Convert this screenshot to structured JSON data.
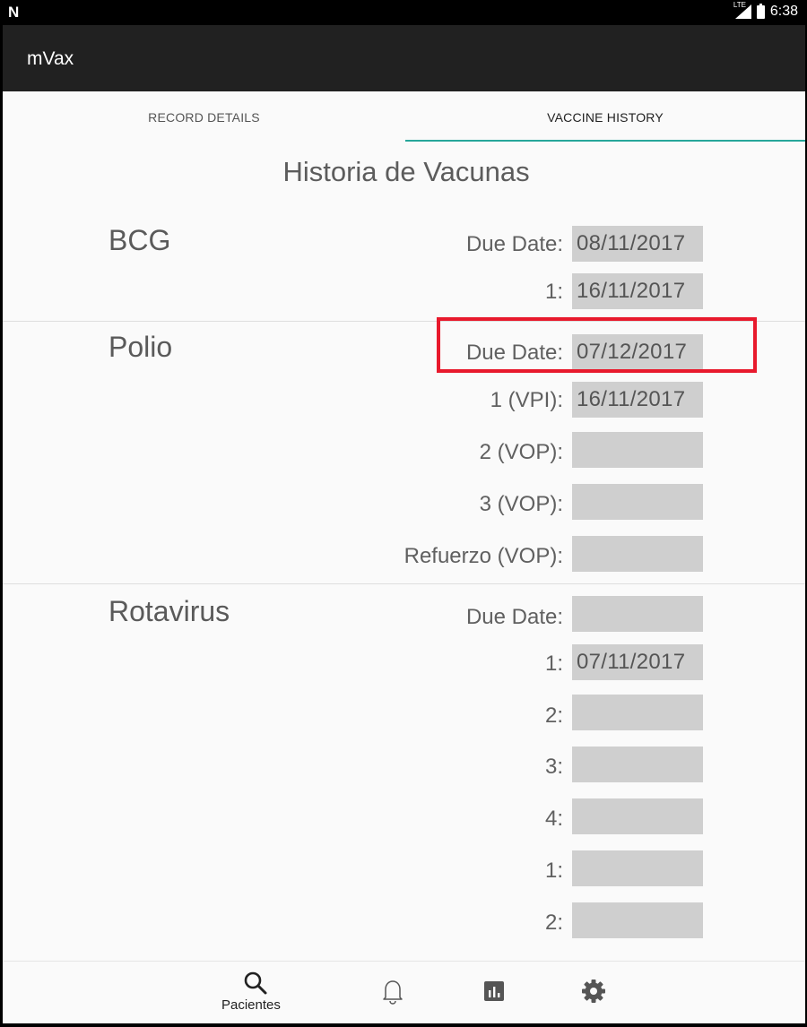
{
  "status_bar": {
    "time": "6:38",
    "network": "LTE"
  },
  "app_bar": {
    "title": "mVax"
  },
  "tabs": [
    {
      "label": "RECORD DETAILS",
      "selected": false
    },
    {
      "label": "VACCINE HISTORY",
      "selected": true
    }
  ],
  "page": {
    "heading": "Historia de Vacunas"
  },
  "vaccines": [
    {
      "name": "BCG",
      "rows": [
        {
          "label": "Due Date:",
          "value": "08/11/2017"
        },
        {
          "label": "1:",
          "value": "16/11/2017"
        }
      ]
    },
    {
      "name": "Polio",
      "rows": [
        {
          "label": "Due Date:",
          "value": "07/12/2017"
        },
        {
          "label": "1 (VPI):",
          "value": "16/11/2017"
        },
        {
          "label": "2 (VOP):",
          "value": ""
        },
        {
          "label": "3 (VOP):",
          "value": ""
        },
        {
          "label": "Refuerzo (VOP):",
          "value": ""
        }
      ]
    },
    {
      "name": "Rotavirus",
      "rows": [
        {
          "label": "Due Date:",
          "value": ""
        },
        {
          "label": "1:",
          "value": "07/11/2017"
        },
        {
          "label": "2:",
          "value": ""
        },
        {
          "label": "3:",
          "value": ""
        },
        {
          "label": "4:",
          "value": ""
        },
        {
          "label": "1:",
          "value": ""
        },
        {
          "label": "2:",
          "value": ""
        }
      ]
    }
  ],
  "bottom_nav": [
    {
      "icon": "search-icon",
      "label": "Pacientes"
    },
    {
      "icon": "bell-icon"
    },
    {
      "icon": "chart-icon"
    },
    {
      "icon": "gear-icon"
    }
  ],
  "colors": {
    "tab_indicator": "#26a69a",
    "highlight": "#e8192c",
    "app_bar": "#212121",
    "field_bg": "#cfcfcf"
  }
}
